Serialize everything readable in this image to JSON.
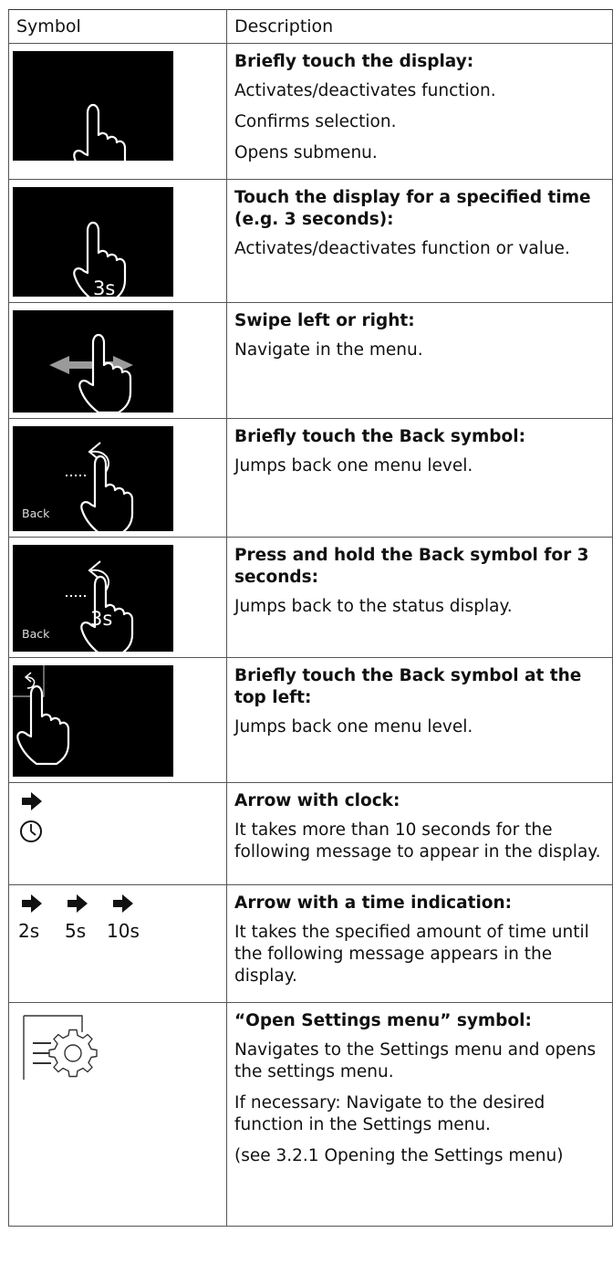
{
  "header": {
    "symbol": "Symbol",
    "description": "Description"
  },
  "rows": [
    {
      "title": "Briefly touch the display:",
      "lines": [
        "Activates/deactivates function.",
        "Confirms selection.",
        "Opens submenu."
      ]
    },
    {
      "title": "Touch the display for a specified time (e.g. 3 seconds):",
      "lines": [
        "Activates/deactivates function or value."
      ],
      "badge": "3s"
    },
    {
      "title": "Swipe left or right:",
      "lines": [
        "Navigate in the menu."
      ]
    },
    {
      "title": "Briefly touch the Back symbol:",
      "lines": [
        "Jumps back one menu level."
      ],
      "back": "Back"
    },
    {
      "title": "Press and hold the Back symbol for 3 seconds:",
      "lines": [
        "Jumps back to the status display."
      ],
      "back": "Back",
      "badge": "3s"
    },
    {
      "title": "Briefly touch the Back symbol at the top left:",
      "lines": [
        "Jumps back one menu level."
      ]
    },
    {
      "title": "Arrow with clock:",
      "lines": [
        "It takes more than 10 seconds for the following message to appear in the display."
      ]
    },
    {
      "title": "Arrow with a time indication:",
      "lines": [
        "It takes the specified amount of time until the following message appears in the display."
      ],
      "times": [
        "2s",
        "5s",
        "10s"
      ]
    },
    {
      "title": "“Open Settings menu” symbol:",
      "lines": [
        "Navigates to the Settings menu and opens the settings menu.",
        "If necessary: Navigate to the desired function in the Settings menu.",
        "(see 3.2.1 Opening the Settings menu)"
      ]
    }
  ]
}
